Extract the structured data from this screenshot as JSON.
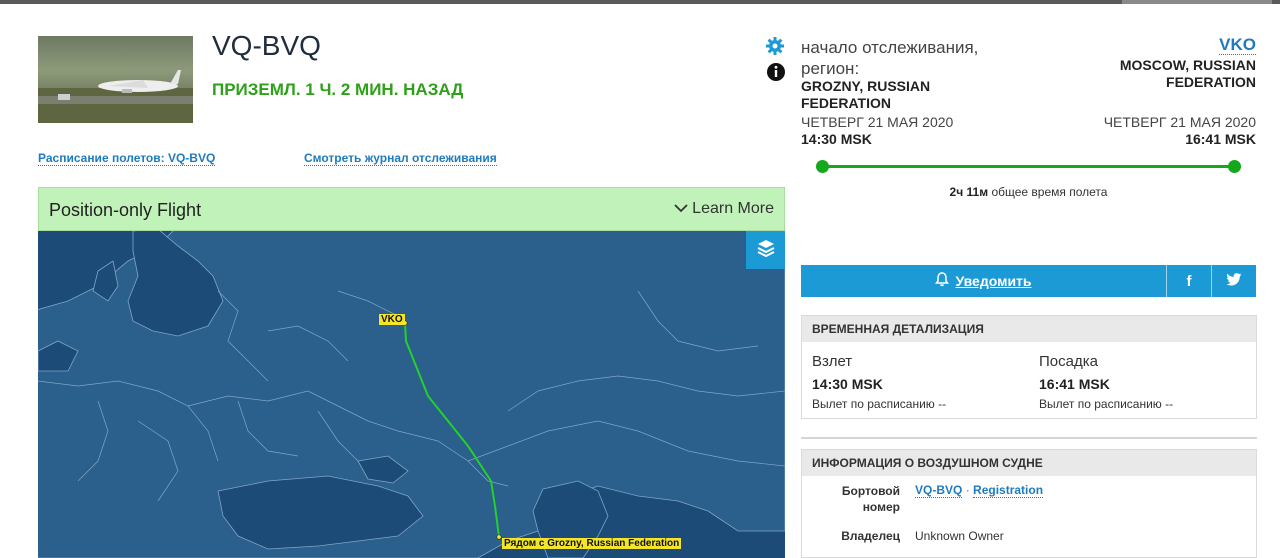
{
  "flight": {
    "registration": "VQ-BVQ",
    "status": "ПРИЗЕМЛ. 1 Ч. 2 МИН. НАЗАД"
  },
  "links": {
    "schedule": "Расписание полетов: VQ-BVQ",
    "tracklog": "Смотреть журнал отслеживания"
  },
  "banner": {
    "title": "Position-only Flight",
    "learn_more": "Learn More"
  },
  "map": {
    "dest_label": "VKO",
    "origin_label": "Рядом с Grozny, Russian Federation",
    "water_color": "#1c4b77",
    "land_color": "#2b5f8c",
    "route_color": "#22d12b"
  },
  "origin": {
    "label": "начало отслеживания, регион:",
    "region": "GROZNY, RUSSIAN FEDERATION",
    "date": "ЧЕТВЕРГ 21 МАЯ 2020",
    "time": "14:30 MSK"
  },
  "destination": {
    "code": "VKO",
    "city": "MOSCOW, RUSSIAN FEDERATION",
    "date": "ЧЕТВЕРГ 21 МАЯ 2020",
    "time": "16:41 MSK"
  },
  "progress": {
    "hours": "2ч",
    "minutes": "11м",
    "suffix": "общее время полета",
    "fraction": 1.0
  },
  "notify": {
    "label": "Уведомить",
    "facebook": "f",
    "twitter": "twitter-icon"
  },
  "timing": {
    "header": "ВРЕМЕННАЯ ДЕТАЛИЗАЦИЯ",
    "takeoff_label": "Взлет",
    "takeoff_time": "14:30 MSK",
    "takeoff_sched": "Вылет по расписанию --",
    "landing_label": "Посадка",
    "landing_time": "16:41 MSK",
    "landing_sched": "Вылет по расписанию --"
  },
  "aircraft": {
    "header": "ИНФОРМАЦИЯ О ВОЗДУШНОМ СУДНЕ",
    "tail_label": "Бортовой номер",
    "tail_value": "VQ-BVQ",
    "registration_link": "Registration",
    "owner_label": "Владелец",
    "owner_value": "Unknown Owner"
  },
  "colors": {
    "accent": "#1c9ad6",
    "status_green": "#2fa01a",
    "banner_green": "#c1f2b9"
  }
}
